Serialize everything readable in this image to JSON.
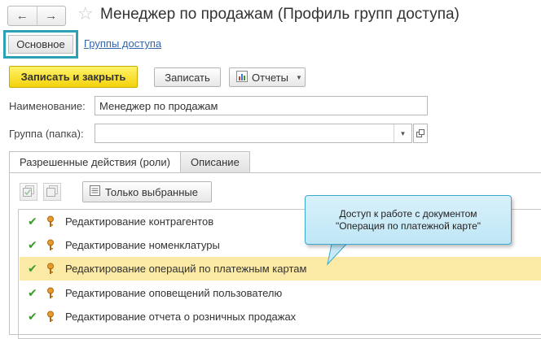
{
  "window": {
    "title": "Менеджер по продажам (Профиль групп доступа)"
  },
  "nav": {
    "back_icon": "arrow-left-icon",
    "forward_icon": "arrow-right-icon",
    "favorite_icon": "star-icon"
  },
  "top_tabs": {
    "main": "Основное",
    "groups_link": "Группы доступа"
  },
  "toolbar": {
    "save_close": "Записать и закрыть",
    "save": "Записать",
    "reports": "Отчеты"
  },
  "fields": {
    "name_label": "Наименование:",
    "name_value": "Менеджер по продажам",
    "group_label": "Группа (папка):",
    "group_value": ""
  },
  "inner_tabs": {
    "roles": "Разрешенные действия (роли)",
    "description": "Описание"
  },
  "roles_toolbar": {
    "only_selected": "Только выбранные"
  },
  "roles": [
    {
      "label": "Редактирование контрагентов",
      "checked": true,
      "selected": false
    },
    {
      "label": "Редактирование номенклатуры",
      "checked": true,
      "selected": false
    },
    {
      "label": "Редактирование операций по платежным картам",
      "checked": true,
      "selected": true
    },
    {
      "label": "Редактирование оповещений пользователю",
      "checked": true,
      "selected": false
    },
    {
      "label": "Редактирование отчета о розничных продажах",
      "checked": true,
      "selected": false
    }
  ],
  "callout": {
    "line1": "Доступ к работе с документом",
    "line2": "\"Операция по платежной карте\""
  },
  "colors": {
    "accent_frame": "#2aa1b5",
    "primary_button": "#f3d20b",
    "selected_row": "#fbe9a6",
    "check": "#3a9a2a",
    "callout_bg": "#cdebf8"
  }
}
